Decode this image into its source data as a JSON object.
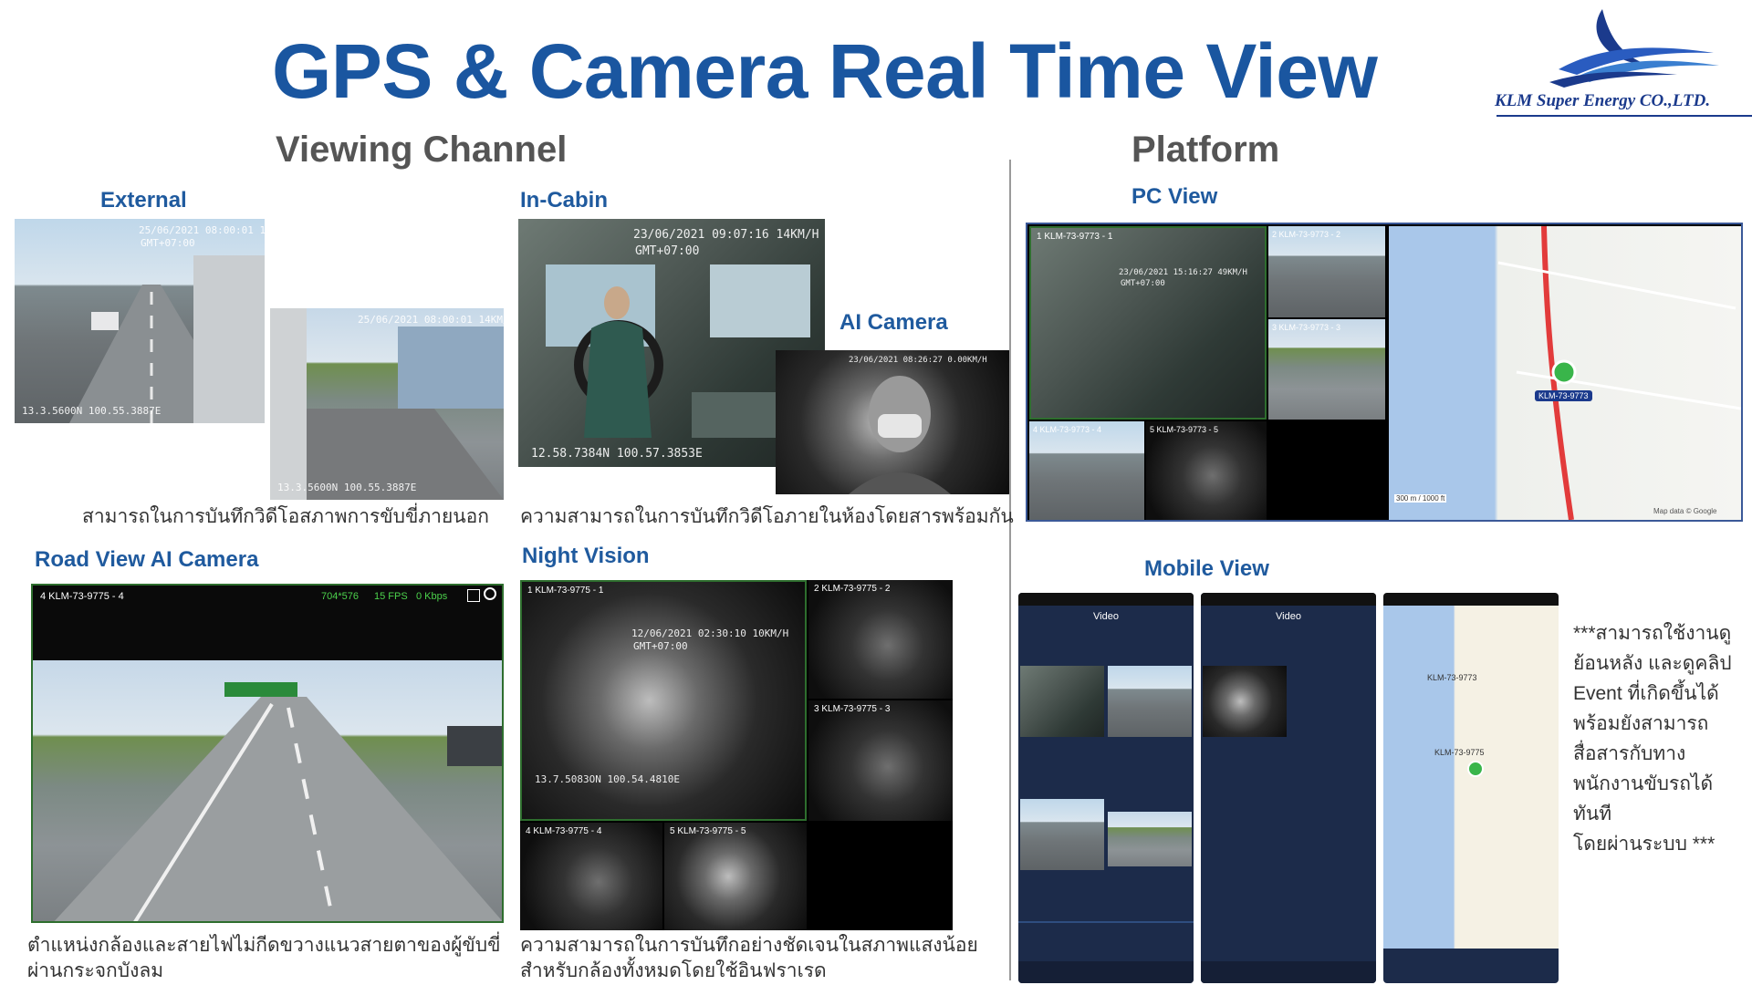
{
  "title": "GPS & Camera Real Time View",
  "sections": {
    "left": "Viewing Channel",
    "right": "Platform"
  },
  "logo": {
    "company": "KLM Super Energy CO.,LTD.",
    "colors": [
      "#1b3a8c",
      "#3a7fd0"
    ]
  },
  "labels": {
    "external": "External",
    "in_cabin": "In-Cabin",
    "ai_camera": "AI Camera",
    "road_view": "Road View AI Camera",
    "night_vision": "Night Vision",
    "pc_view": "PC View",
    "mobile_view": "Mobile View"
  },
  "captions": {
    "external": "สามารถในการบันทึกวิดีโอสภาพการขับขี่ภายนอก",
    "in_cabin": "ความสามารถในการบันทึกวิดีโอภายในห้องโดยสารพร้อมกัน",
    "road_view_1": "ตำแหน่งกล้องและสายไฟไม่กีดขวางแนวสายตาของผู้ขับขี่",
    "road_view_2": "ผ่านกระจกบังลม",
    "night_vision_1": "ความสามารถในการบันทึกอย่างชัดเจนในสภาพแสงน้อย",
    "night_vision_2": "สำหรับกล้องทั้งหมดโดยใช้อินฟราเรด"
  },
  "note_lines": [
    "***สามารถใช้งานดู",
    "ย้อนหลัง และดูคลิป",
    "Event ที่เกิดขึ้นได้",
    "พร้อมยังสามารถ",
    "สื่อสารกับทาง",
    "พนักงานขับรถได้ทันที",
    "โดยผ่านระบบ ***"
  ],
  "osd": {
    "external_ts": "25/06/2021 08:00:01 14KM/H",
    "external_tz": "GMT+07:00",
    "external_gps": "13.3.5600N 100.55.3887E",
    "in_cabin_ts": "23/06/2021 09:07:16  14KM/H",
    "in_cabin_tz": "GMT+07:00",
    "in_cabin_gps": "12.58.7384N 100.57.3853E",
    "road_tile": "4 KLM-73-9775 - 4",
    "road_res": "704*576",
    "road_fps": "15 FPS",
    "road_kbps": "0 Kbps",
    "nv_tile1": "1 KLM-73-9775 - 1",
    "nv_tile2": "2 KLM-73-9775 - 2",
    "nv_tile3": "3 KLM-73-9775 - 3",
    "nv_tile4": "4 KLM-73-9775 - 4",
    "nv_tile5": "5 KLM-73-9775 - 5",
    "nv_ts": "12/06/2021 02:30:10   10KM/H",
    "nv_tz": "GMT+07:00",
    "nv_gps": "13.7.5083ON 100.54.4810E",
    "pc_tile1": "1 KLM-73-9773 - 1",
    "pc_tile2": "2 KLM-73-9773 - 2",
    "pc_tile3": "3 KLM-73-9773 - 3",
    "pc_tile4": "4 KLM-73-9773 - 4",
    "pc_tile5": "5 KLM-73-9773 - 5",
    "pc_ts": "23/06/2021 15:16:27   49KM/H",
    "pc_tz": "GMT+07:00",
    "map_vehicle": "KLM-73-9773",
    "map_scale1": "300 m",
    "map_scale2": "1000 ft",
    "map_credit": "Map data © Google"
  },
  "mobile": {
    "screen1_title": "Video",
    "screen2_title": "Video",
    "map_vehicle1": "KLM-73-9773",
    "map_vehicle2": "KLM-73-9775"
  }
}
